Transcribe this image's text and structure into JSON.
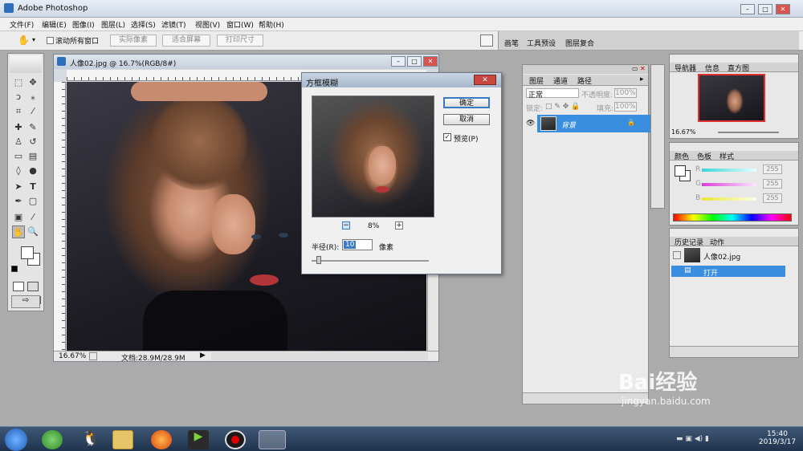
{
  "app": {
    "title": "Adobe Photoshop"
  },
  "menubar": [
    "文件(F)",
    "编辑(E)",
    "图像(I)",
    "图层(L)",
    "选择(S)",
    "滤镜(T)",
    "视图(V)",
    "窗口(W)",
    "帮助(H)"
  ],
  "options": {
    "scroll_all": "滚动所有窗口",
    "actual_pixels": "实际像素",
    "fit_screen": "适合屏幕",
    "print_size": "打印尺寸",
    "tabs": [
      "画笔",
      "工具预设",
      "图层复合"
    ]
  },
  "document": {
    "title": "人像02.jpg @ 16.7%(RGB/8#)",
    "zoom": "16.67%",
    "doc_size": "文档:28.9M/28.9M"
  },
  "dialog": {
    "title": "方框模糊",
    "ok": "确定",
    "cancel": "取消",
    "preview_label": "预览(P)",
    "zoom_percent": "8%",
    "radius_label": "半径(R):",
    "radius_value": "10",
    "unit": "像素"
  },
  "layers_panel": {
    "tabs": [
      "图层",
      "通道",
      "路径"
    ],
    "blend_mode": "正常",
    "opacity_label": "不透明度:",
    "opacity_value": "100%",
    "lock_label": "锁定:",
    "fill_label": "填充:",
    "fill_value": "100%",
    "layer_name": "背景"
  },
  "navigator": {
    "tabs": [
      "导航器",
      "信息",
      "直方图"
    ],
    "zoom": "16.67%"
  },
  "color_panel": {
    "tabs": [
      "颜色",
      "色板",
      "样式"
    ],
    "channels": [
      {
        "label": "R",
        "value": "255",
        "color": "#3cd6d6"
      },
      {
        "label": "G",
        "value": "255",
        "color": "#d640d6"
      },
      {
        "label": "B",
        "value": "255",
        "color": "#e6e63c"
      }
    ]
  },
  "history_panel": {
    "tabs": [
      "历史记录",
      "动作"
    ],
    "snapshot": "人像02.jpg",
    "item": "打开"
  },
  "taskbar": {
    "time": "15:40",
    "date": "2019/3/17"
  },
  "watermark": {
    "brand": "Bai经验",
    "url": "jingyan.baidu.com"
  }
}
